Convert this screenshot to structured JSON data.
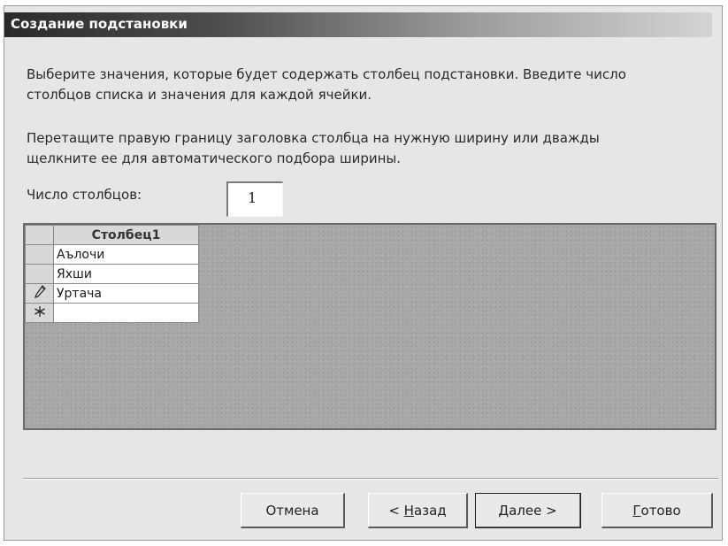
{
  "window": {
    "title": "Создание подстановки"
  },
  "instructions": {
    "p1_line1": "Выберите значения, которые будет содержать столбец подстановки. Введите число",
    "p1_line2": "столбцов списка и значения для каждой ячейки.",
    "p2_line1": "Перетащите правую границу заголовка столбца на нужную ширину или дважды",
    "p2_line2": "щелкните ее для автоматического подбора ширины."
  },
  "columns_count": {
    "label": "Число столбцов:",
    "value": "1"
  },
  "grid": {
    "column_header": "Столбец1",
    "rows": [
      {
        "selector": "",
        "value": "Аълочи"
      },
      {
        "selector": "",
        "value": "Яхши"
      },
      {
        "selector": "pencil",
        "value": "Уртача"
      },
      {
        "selector": "new",
        "value": ""
      }
    ]
  },
  "buttons": {
    "cancel": "Отмена",
    "back_prefix": "< ",
    "back_hotkey": "Н",
    "back_rest": "азад",
    "next_hotkey": "Д",
    "next_rest": "алее >",
    "finish_hotkey": "Г",
    "finish_rest": "отово"
  },
  "icons": {
    "edit": "pencil-icon",
    "new_record": "asterisk-icon"
  }
}
